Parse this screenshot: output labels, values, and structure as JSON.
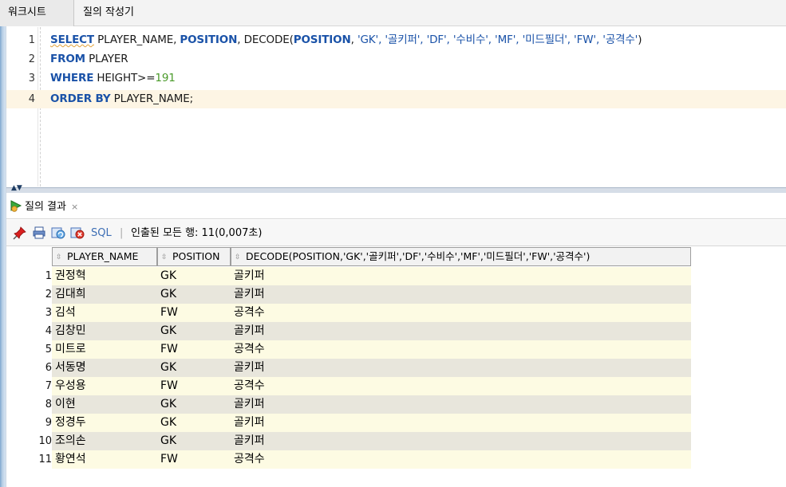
{
  "tabs": {
    "worksheet": "워크시트",
    "query_builder": "질의 작성기"
  },
  "editor": {
    "line_numbers": [
      "1",
      "2",
      "3",
      "4"
    ],
    "line1": {
      "select": "SELECT",
      "cols": " PLAYER_NAME, ",
      "position": "POSITION",
      "comma1": ", DECODE(",
      "position2": "POSITION",
      "comma2": ", ",
      "args": "'GK', '골키퍼', 'DF', '수비수', 'MF', '미드필더', 'FW', '공격수'",
      "close": ")"
    },
    "line2": {
      "from": "FROM",
      "table": " PLAYER"
    },
    "line3": {
      "where": "WHERE",
      "cond": " HEIGHT>=",
      "value": "191"
    },
    "line4": {
      "order": "ORDER BY",
      "col": " PLAYER_NAME;"
    }
  },
  "results": {
    "tab_label": "질의 결과",
    "close_glyph": "×",
    "toolbar": {
      "sql_label": "SQL",
      "separator": "|",
      "status": "인출된 모든 행: 11(0,007초)"
    },
    "columns": [
      "PLAYER_NAME",
      "POSITION",
      "DECODE(POSITION,'GK','골키퍼','DF','수비수','MF','미드필더','FW','공격수')"
    ],
    "rows": [
      {
        "n": "1",
        "name": "권정혁",
        "pos": "GK",
        "decode": "골키퍼"
      },
      {
        "n": "2",
        "name": "김대희",
        "pos": "GK",
        "decode": "골키퍼"
      },
      {
        "n": "3",
        "name": "김석",
        "pos": "FW",
        "decode": "공격수"
      },
      {
        "n": "4",
        "name": "김창민",
        "pos": "GK",
        "decode": "골키퍼"
      },
      {
        "n": "5",
        "name": "미트로",
        "pos": "FW",
        "decode": "공격수"
      },
      {
        "n": "6",
        "name": "서동명",
        "pos": "GK",
        "decode": "골키퍼"
      },
      {
        "n": "7",
        "name": "우성용",
        "pos": "FW",
        "decode": "공격수"
      },
      {
        "n": "8",
        "name": "이현",
        "pos": "GK",
        "decode": "골키퍼"
      },
      {
        "n": "9",
        "name": "정경두",
        "pos": "GK",
        "decode": "골키퍼"
      },
      {
        "n": "10",
        "name": "조의손",
        "pos": "GK",
        "decode": "골키퍼"
      },
      {
        "n": "11",
        "name": "황연석",
        "pos": "FW",
        "decode": "공격수"
      }
    ]
  },
  "colors": {
    "keyword": "#1a52a8",
    "number": "#4a9a2a",
    "row_odd": "#fdfbe3",
    "row_even": "#e8e6dc",
    "current_line": "#fdf5e4"
  },
  "icons": [
    "pin-icon",
    "print-icon",
    "refresh-icon",
    "delete-icon",
    "play-icon",
    "sort-icon"
  ]
}
